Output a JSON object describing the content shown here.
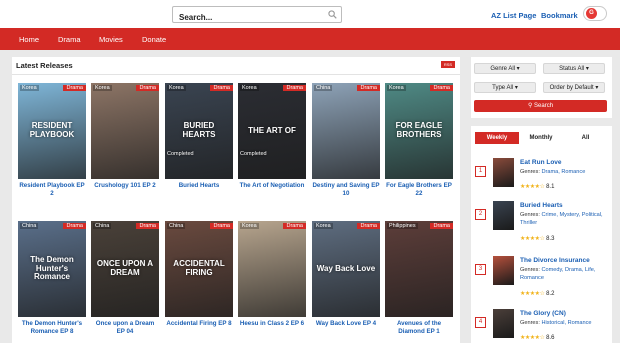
{
  "header": {
    "search_placeholder": "Search...",
    "az_list": "AZ List Page",
    "bookmark": "Bookmark",
    "avatar_letter": "G"
  },
  "nav": [
    "Home",
    "Drama",
    "Movies",
    "Donate"
  ],
  "latest": {
    "title": "Latest Releases",
    "rss": "RSS",
    "cards": [
      {
        "title": "Resident Playbook EP 2",
        "country": "Korea",
        "type": "Drama",
        "status": "",
        "overlay": "RESIDENT PLAYBOOK",
        "color": "#7fb6d8"
      },
      {
        "title": "Crushology 101 EP 2",
        "country": "Korea",
        "type": "Drama",
        "status": "",
        "overlay": "",
        "color": "#8d7566"
      },
      {
        "title": "Buried Hearts",
        "country": "Korea",
        "type": "Drama",
        "status": "Completed",
        "overlay": "BURIED HEARTS",
        "color": "#3a4451"
      },
      {
        "title": "The Art of Negotiation",
        "country": "Korea",
        "type": "Drama",
        "status": "Completed",
        "overlay": "THE ART OF",
        "color": "#2b2d33"
      },
      {
        "title": "Destiny and Saving EP 10",
        "country": "China",
        "type": "Drama",
        "status": "",
        "overlay": "",
        "color": "#8ea3b8"
      },
      {
        "title": "For Eagle Brothers EP 22",
        "country": "Korea",
        "type": "Drama",
        "status": "",
        "overlay": "FOR EAGLE BROTHERS",
        "color": "#4f8a85"
      },
      {
        "title": "The Demon Hunter's Romance EP 8",
        "country": "China",
        "type": "Drama",
        "status": "",
        "overlay": "The Demon Hunter's Romance",
        "color": "#5a6f8a"
      },
      {
        "title": "Once upon a Dream EP 04",
        "country": "China",
        "type": "Drama",
        "status": "",
        "overlay": "ONCE UPON A DREAM",
        "color": "#4a4139"
      },
      {
        "title": "Accidental Firing EP 8",
        "country": "China",
        "type": "Drama",
        "status": "",
        "overlay": "ACCIDENTAL FIRING",
        "color": "#6a4a3f"
      },
      {
        "title": "Heesu in Class 2 EP 6",
        "country": "Korea",
        "type": "Drama",
        "status": "",
        "overlay": "",
        "color": "#b7a58e"
      },
      {
        "title": "Way Back Love EP 4",
        "country": "Korea",
        "type": "Drama",
        "status": "",
        "overlay": "Way Back Love",
        "color": "#5e6d80"
      },
      {
        "title": "Avenues of the Diamond EP 1",
        "country": "Philippines",
        "type": "Drama",
        "status": "",
        "overlay": "",
        "color": "#5d3e3a"
      }
    ]
  },
  "filters": {
    "genre": "Genre All",
    "status": "Status All",
    "type": "Type All",
    "order": "Order by Default",
    "search": "Search"
  },
  "popular": {
    "tabs": [
      "Weekly",
      "Monthly",
      "All"
    ],
    "genres_label": "Genres:",
    "items": [
      {
        "rank": "1",
        "title": "Eat Run Love",
        "genres": "Drama, Romance",
        "rating": "8.1",
        "color": "#8a4b3b"
      },
      {
        "rank": "2",
        "title": "Buried Hearts",
        "genres": "Crime, Mystery, Political, Thriller",
        "rating": "8.3",
        "color": "#3a4451"
      },
      {
        "rank": "3",
        "title": "The Divorce Insurance",
        "genres": "Comedy, Drama, Life, Romance",
        "rating": "8.2",
        "color": "#b5503c"
      },
      {
        "rank": "4",
        "title": "The Glory (CN)",
        "genres": "Historical, Romance",
        "rating": "8.6",
        "color": "#4b3f3a"
      }
    ]
  }
}
